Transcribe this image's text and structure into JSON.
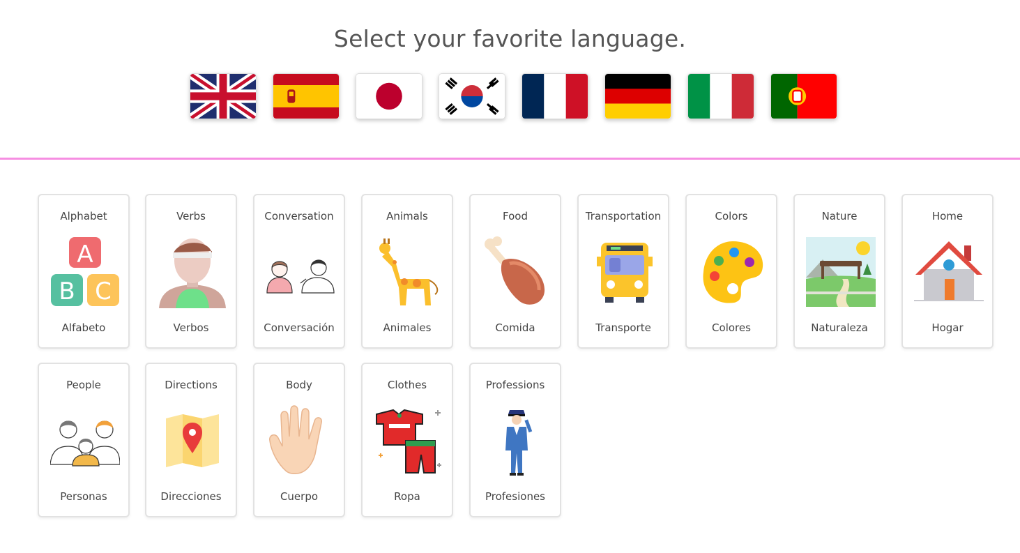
{
  "header": {
    "title": "Select your favorite language."
  },
  "languages": [
    {
      "name": "English",
      "icon": "uk-flag-icon"
    },
    {
      "name": "Spanish",
      "icon": "spain-flag-icon"
    },
    {
      "name": "Japanese",
      "icon": "japan-flag-icon"
    },
    {
      "name": "Korean",
      "icon": "korea-flag-icon"
    },
    {
      "name": "French",
      "icon": "france-flag-icon"
    },
    {
      "name": "German",
      "icon": "germany-flag-icon"
    },
    {
      "name": "Italian",
      "icon": "italy-flag-icon"
    },
    {
      "name": "Portuguese",
      "icon": "portugal-flag-icon"
    }
  ],
  "colors": {
    "divider": "#f68ee2",
    "title": "#555555",
    "card_border": "#e2e2e2"
  },
  "categories": [
    {
      "label": "Alphabet",
      "translation": "Alfabeto",
      "icon": "alphabet-blocks-icon"
    },
    {
      "label": "Verbs",
      "translation": "Verbos",
      "icon": "athlete-icon"
    },
    {
      "label": "Conversation",
      "translation": "Conversación",
      "icon": "conversation-people-icon"
    },
    {
      "label": "Animals",
      "translation": "Animales",
      "icon": "giraffe-icon"
    },
    {
      "label": "Food",
      "translation": "Comida",
      "icon": "drumstick-icon"
    },
    {
      "label": "Transportation",
      "translation": "Transporte",
      "icon": "bus-icon"
    },
    {
      "label": "Colors",
      "translation": "Colores",
      "icon": "palette-icon"
    },
    {
      "label": "Nature",
      "translation": "Naturaleza",
      "icon": "landscape-icon"
    },
    {
      "label": "Home",
      "translation": "Hogar",
      "icon": "house-icon"
    },
    {
      "label": "People",
      "translation": "Personas",
      "icon": "family-icon"
    },
    {
      "label": "Directions",
      "translation": "Direcciones",
      "icon": "map-pin-icon"
    },
    {
      "label": "Body",
      "translation": "Cuerpo",
      "icon": "hand-icon"
    },
    {
      "label": "Clothes",
      "translation": "Ropa",
      "icon": "clothes-icon"
    },
    {
      "label": "Professions",
      "translation": "Profesiones",
      "icon": "police-officer-icon"
    }
  ]
}
